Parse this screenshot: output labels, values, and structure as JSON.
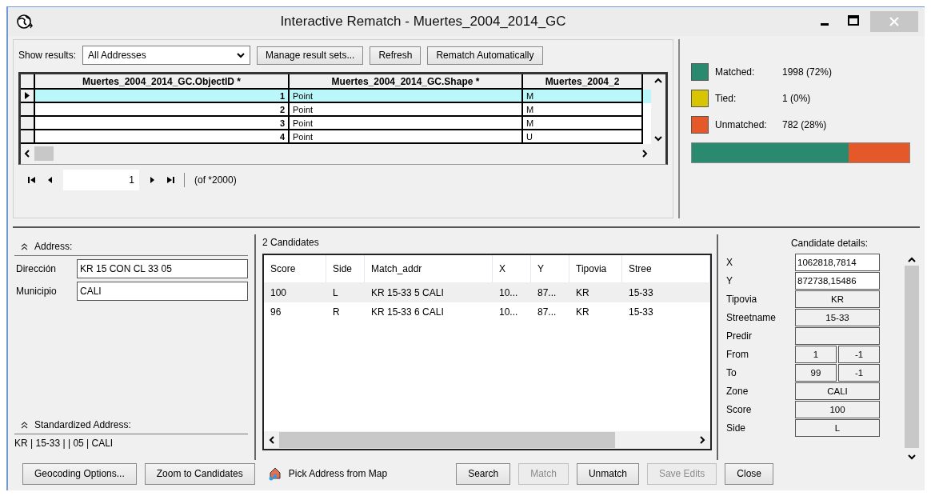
{
  "window": {
    "title": "Interactive Rematch - Muertes_2004_2014_GC"
  },
  "results": {
    "show_label": "Show results:",
    "filter": "All Addresses",
    "buttons": [
      "Manage result sets...",
      "Refresh",
      "Rematch Automatically"
    ],
    "table": {
      "columns": [
        "Muertes_2004_2014_GC.ObjectID *",
        "Muertes_2004_2014_GC.Shape *",
        "Muertes_2004_2"
      ],
      "rows": [
        {
          "cells": [
            "1",
            "Point",
            "M"
          ],
          "selected": true
        },
        {
          "cells": [
            "2",
            "Point",
            "M"
          ],
          "selected": false
        },
        {
          "cells": [
            "3",
            "Point",
            "M"
          ],
          "selected": false
        },
        {
          "cells": [
            "4",
            "Point",
            "U"
          ],
          "selected": false
        }
      ]
    },
    "pager": {
      "page": "1",
      "total": "(of *2000)"
    }
  },
  "stats": {
    "items": [
      {
        "label": "Matched:",
        "value": "1998 (72%)",
        "color": "#2a8a70",
        "level": 0.72
      },
      {
        "label": "Tied:",
        "value": "1 (0%)",
        "color": "#d8c400"
      },
      {
        "label": "Unmatched:",
        "value": "782 (28%)",
        "color": "#e4582a",
        "level": 0.28
      }
    ]
  },
  "address": {
    "title": "Address:",
    "fields": [
      {
        "label": "Dirección",
        "value": "KR 15 CON CL 33 05"
      },
      {
        "label": "Municipio",
        "value": "CALI"
      }
    ],
    "standardized_title": "Standardized Address:",
    "standardized": "KR | 15-33 |  | 05 | CALI"
  },
  "candidates": {
    "title": "2 Candidates",
    "columns": [
      "Score",
      "Side",
      "Match_addr",
      "X",
      "Y",
      "Tipovia",
      "Stree"
    ],
    "rows": [
      {
        "cells": [
          "100",
          "L",
          "KR 15-33 5 CALI",
          "10...",
          "87...",
          "KR",
          "15-33"
        ],
        "selected": true
      },
      {
        "cells": [
          "96",
          "R",
          "KR 15-33 6 CALI",
          "10...",
          "87...",
          "KR",
          "15-33"
        ],
        "selected": false
      }
    ]
  },
  "details": {
    "title": "Candidate details:",
    "rows": [
      {
        "label": "X",
        "values": [
          "1062818,7814"
        ],
        "kind": "text"
      },
      {
        "label": "Y",
        "values": [
          "872738,15486"
        ],
        "kind": "text"
      },
      {
        "label": "Tipovia",
        "values": [
          "KR"
        ],
        "kind": "text"
      },
      {
        "label": "Streetname",
        "values": [
          "15-33"
        ],
        "kind": "text"
      },
      {
        "label": "Predir",
        "kind": "text"
      },
      {
        "label": "From",
        "values": [
          "1",
          "-1"
        ],
        "kind": "pair"
      },
      {
        "label": "To",
        "values": [
          "99",
          "-1"
        ],
        "kind": "pair"
      },
      {
        "label": "Zone",
        "values": [
          "CALI"
        ],
        "kind": "text"
      },
      {
        "label": "Score",
        "values": [
          "100"
        ],
        "kind": "text"
      },
      {
        "label": "Side",
        "values": [
          "L"
        ],
        "kind": "text"
      }
    ]
  },
  "buttons": [
    {
      "label": "Geocoding Options...",
      "kind": "button",
      "disabled": false
    },
    {
      "label": "Zoom to Candidates",
      "kind": "button",
      "disabled": false
    },
    {
      "label": "Pick Address from Map",
      "kind": "tool",
      "disabled": false
    },
    {
      "label": "Search",
      "kind": "button",
      "disabled": false
    },
    {
      "label": "Match",
      "kind": "button",
      "disabled": true
    },
    {
      "label": "Unmatch",
      "kind": "button",
      "disabled": false
    },
    {
      "label": "Save Edits",
      "kind": "button",
      "disabled": true
    },
    {
      "label": "Close",
      "kind": "button",
      "disabled": false
    }
  ]
}
